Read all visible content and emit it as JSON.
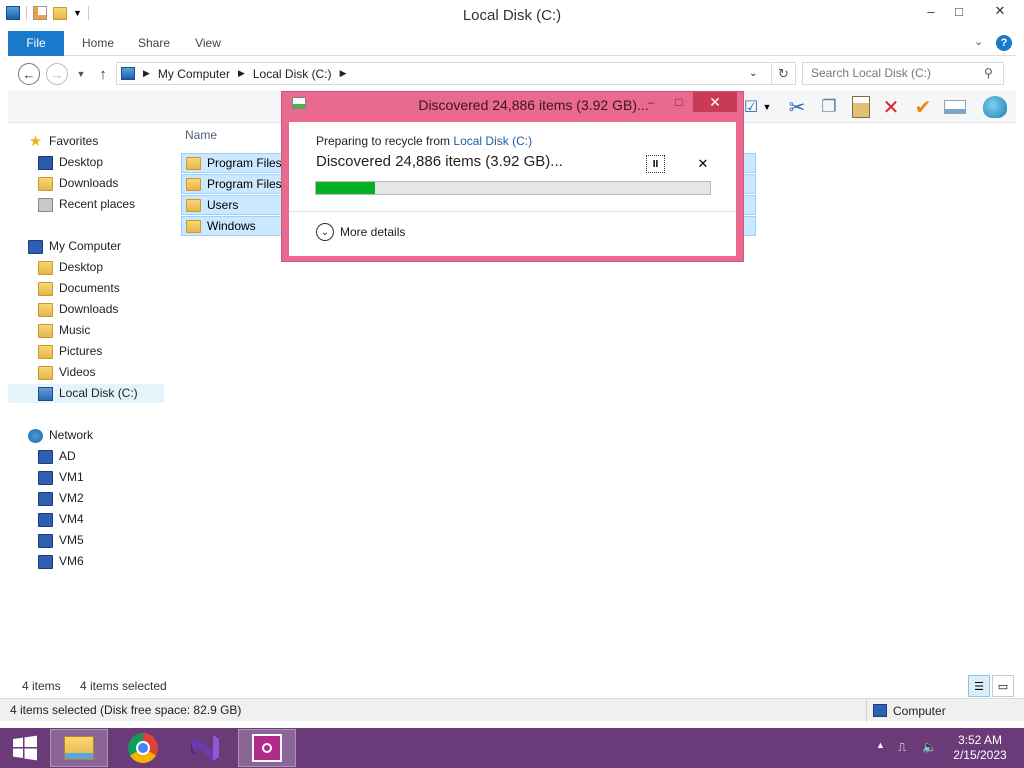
{
  "window": {
    "title": "Local Disk (C:)",
    "controls": {
      "minimize": "–",
      "maximize": "□",
      "close": "✕"
    }
  },
  "ribbon": {
    "tabs": [
      {
        "label": "File"
      },
      {
        "label": "Home"
      },
      {
        "label": "Share"
      },
      {
        "label": "View"
      }
    ]
  },
  "address": {
    "crumbs": [
      "My Computer",
      "Local Disk (C:)"
    ],
    "search_placeholder": "Search Local Disk (C:)"
  },
  "nav": {
    "favorites": {
      "label": "Favorites",
      "items": [
        "Desktop",
        "Downloads",
        "Recent places"
      ]
    },
    "computer": {
      "label": "My Computer",
      "items": [
        "Desktop",
        "Documents",
        "Downloads",
        "Music",
        "Pictures",
        "Videos",
        "Local Disk (C:)"
      ]
    },
    "network": {
      "label": "Network",
      "items": [
        "AD",
        "VM1",
        "VM2",
        "VM4",
        "VM5",
        "VM6"
      ]
    }
  },
  "content": {
    "column_name": "Name",
    "files": [
      "Program Files",
      "Program Files",
      "Users",
      "Windows"
    ]
  },
  "itembar": {
    "count": "4 items",
    "selected": "4 items selected"
  },
  "status": {
    "left": "4 items selected (Disk free space: 82.9 GB)",
    "right": "Computer"
  },
  "dialog": {
    "title": "Discovered 24,886 items (3.92 GB)...",
    "from_prefix": "Preparing to recycle from ",
    "from_link": "Local Disk (C:)",
    "headline": "Discovered 24,886 items (3.92 GB)...",
    "pause": "II",
    "cancel": "✕",
    "progress_fraction": 0.15,
    "more_details": "More details"
  },
  "taskbar": {
    "time": "3:52 AM",
    "date": "2/15/2023"
  },
  "colors": {
    "accent": "#1979ca",
    "dialog_frame": "#e9698f",
    "taskbar": "#6b3a79",
    "progress": "#06b025",
    "selection": "#cce8ff"
  }
}
